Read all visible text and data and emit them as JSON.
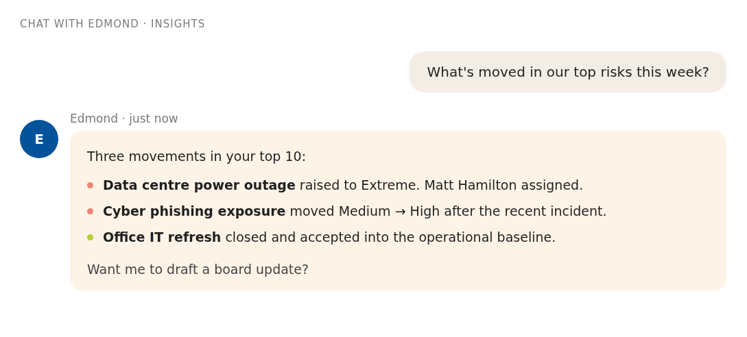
{
  "header": "CHAT WITH EDMOND · INSIGHTS",
  "user_message": "What's moved in our top risks this week?",
  "reply": {
    "avatar": "E",
    "meta": "Edmond · just now",
    "intro": "Three movements in your top 10:",
    "items": [
      {
        "text": "**Data centre power outage** raised to Extreme. Matt Hamilton assigned.",
        "color": "#ee8577"
      },
      {
        "text": "**Cyber phishing exposure** moved Medium → High after the recent incident.",
        "color": "#ee8577"
      },
      {
        "text": "**Office IT refresh** closed and accepted into the operational baseline.",
        "color": "#b5cf35"
      }
    ],
    "closing": "Want me to draft a board update?"
  }
}
